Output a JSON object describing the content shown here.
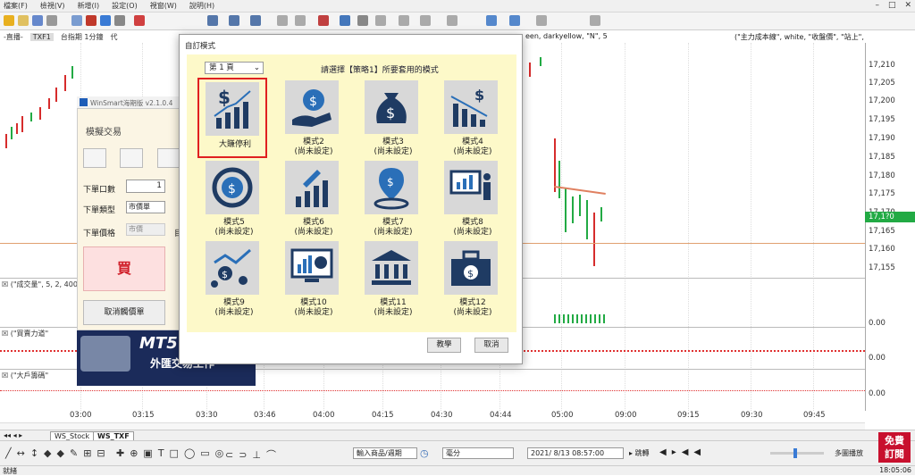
{
  "menu": [
    "檔案(F)",
    "檢視(V)",
    "新增(I)",
    "設定(O)",
    "視窗(W)",
    "說明(H)"
  ],
  "infobar": {
    "left": "-直播-",
    "symbol": "TXF1",
    "period": "台指期 1分鐘",
    "extra": "代",
    "chart_params": "een, darkyellow, \"N\", 5",
    "right_params": "(\"主力成本線\", white, \"收盤價\", \"站上\", \""
  },
  "price_axis": [
    "17,210",
    "17,205",
    "17,200",
    "17,195",
    "17,190",
    "17,185",
    "17,180",
    "17,175",
    "17,170",
    "17,165",
    "17,160",
    "17,155"
  ],
  "price_tag": "17,1?0",
  "subcharts": [
    {
      "label": "(\"成交量\", 5, 2, 400",
      "value": ""
    },
    {
      "label": "(\"買賣力道\"",
      "value": "0.00"
    },
    {
      "label": "(\"大戶籌碼\"",
      "value": "0.00"
    }
  ],
  "subchart_zero": "0.00",
  "time_axis": [
    "03:00",
    "03:15",
    "03:30",
    "03:46",
    "04:00",
    "04:15",
    "04:30",
    "04:44",
    "05:00",
    "09:00",
    "09:15",
    "09:30",
    "09:45"
  ],
  "tabs": [
    "WS_Stock",
    "WS_TXF"
  ],
  "bottom": {
    "product": "輸入商品/週期",
    "interval": "毫分",
    "datetime": "2021/ 8/13 08:57:00",
    "jump": "跳轉",
    "multi": "多圖播放"
  },
  "status": "就緒",
  "clock": "18:05:06",
  "trade_panel": {
    "app_title": "WinSmart海期版 v2.1.0.4",
    "title": "模擬交易",
    "qty_label": "下單口數",
    "qty_value": "1",
    "type_label": "下單類型",
    "type_value": "市價單",
    "price_label": "下單價格",
    "price_value": "市價",
    "extra": "目",
    "buy": "買",
    "cancel": "取消觸價單"
  },
  "banner": {
    "line1": "MT5",
    "line2": "外匯交易工作"
  },
  "dialog": {
    "title": "自訂模式",
    "page": "第 1 頁",
    "prompt": "請選擇【策略1】所要套用的模式",
    "modes": [
      {
        "name": "大賺停利",
        "sub": "",
        "icon": "rising-bar-chart-icon"
      },
      {
        "name": "模式2",
        "sub": "(尚未設定)",
        "icon": "hand-gear-dollar-icon"
      },
      {
        "name": "模式3",
        "sub": "(尚未設定)",
        "icon": "money-bag-icon"
      },
      {
        "name": "模式4",
        "sub": "(尚未設定)",
        "icon": "falling-bar-chart-icon"
      },
      {
        "name": "模式5",
        "sub": "(尚未設定)",
        "icon": "dollar-circle-icon"
      },
      {
        "name": "模式6",
        "sub": "(尚未設定)",
        "icon": "rocket-chart-icon"
      },
      {
        "name": "模式7",
        "sub": "(尚未設定)",
        "icon": "location-dollar-icon"
      },
      {
        "name": "模式8",
        "sub": "(尚未設定)",
        "icon": "presentation-icon"
      },
      {
        "name": "模式9",
        "sub": "(尚未設定)",
        "icon": "network-dollar-icon"
      },
      {
        "name": "模式10",
        "sub": "(尚未設定)",
        "icon": "monitor-chart-icon"
      },
      {
        "name": "模式11",
        "sub": "(尚未設定)",
        "icon": "bank-icon"
      },
      {
        "name": "模式12",
        "sub": "(尚未設定)",
        "icon": "briefcase-icon"
      }
    ],
    "ok": "教學",
    "cancel": "取消"
  },
  "watermark": {
    "line1": "免費",
    "line2": "訂閱"
  },
  "colors": {
    "dialog_bg": "#fdf9c9",
    "icon_dark": "#1f3b63",
    "icon_blue": "#2a6fb8",
    "select_red": "#e02020",
    "up_green": "#22aa44",
    "down_red": "#d62c2c"
  }
}
